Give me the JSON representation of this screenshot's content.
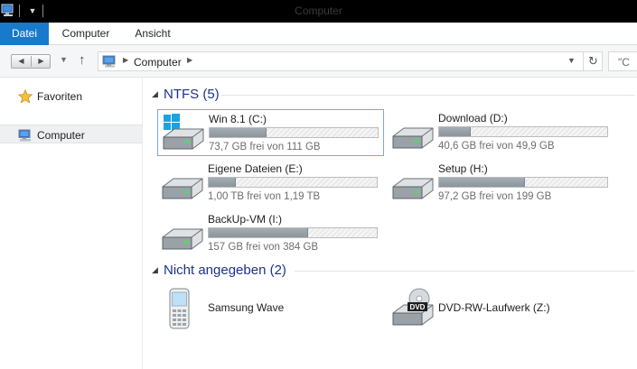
{
  "window": {
    "title": "Computer"
  },
  "ribbon": {
    "tabs": [
      {
        "label": "Datei",
        "active": true
      },
      {
        "label": "Computer"
      },
      {
        "label": "Ansicht"
      }
    ]
  },
  "address": {
    "crumbs": [
      "Computer"
    ],
    "search_placeholder": "\"C"
  },
  "nav": {
    "items": [
      {
        "label": "Favoriten",
        "icon": "star-icon"
      },
      {
        "label": "Computer",
        "icon": "computer-icon",
        "selected": true
      }
    ]
  },
  "groups": {
    "ntfs": {
      "title": "NTFS (5)",
      "drives": [
        {
          "name": "Win 8.1 (C:)",
          "free_text": "73,7 GB frei von 111 GB",
          "used_fraction": 0.34,
          "icon": "windows-drive-icon",
          "selected": true
        },
        {
          "name": "Download (D:)",
          "free_text": "40,6 GB frei von 49,9 GB",
          "used_fraction": 0.19,
          "icon": "hard-drive-icon"
        },
        {
          "name": "Eigene Dateien (E:)",
          "free_text": "1,00 TB frei von 1,19 TB",
          "used_fraction": 0.16,
          "icon": "hard-drive-icon"
        },
        {
          "name": "Setup (H:)",
          "free_text": "97,2 GB frei von 199 GB",
          "used_fraction": 0.51,
          "icon": "hard-drive-icon"
        },
        {
          "name": "BackUp-VM (I:)",
          "free_text": "157 GB frei von 384 GB",
          "used_fraction": 0.59,
          "icon": "hard-drive-icon"
        }
      ]
    },
    "unspecified": {
      "title": "Nicht angegeben (2)",
      "devices": [
        {
          "name": "Samsung Wave",
          "icon": "phone-icon"
        },
        {
          "name": "DVD-RW-Laufwerk (Z:)",
          "icon": "dvd-drive-icon"
        }
      ]
    }
  },
  "colors": {
    "ribbon_file_tab": "#1979ca",
    "group_title": "#1e3287",
    "usage_bar": "#8a959c",
    "selection_border": "#7fa9d6"
  }
}
